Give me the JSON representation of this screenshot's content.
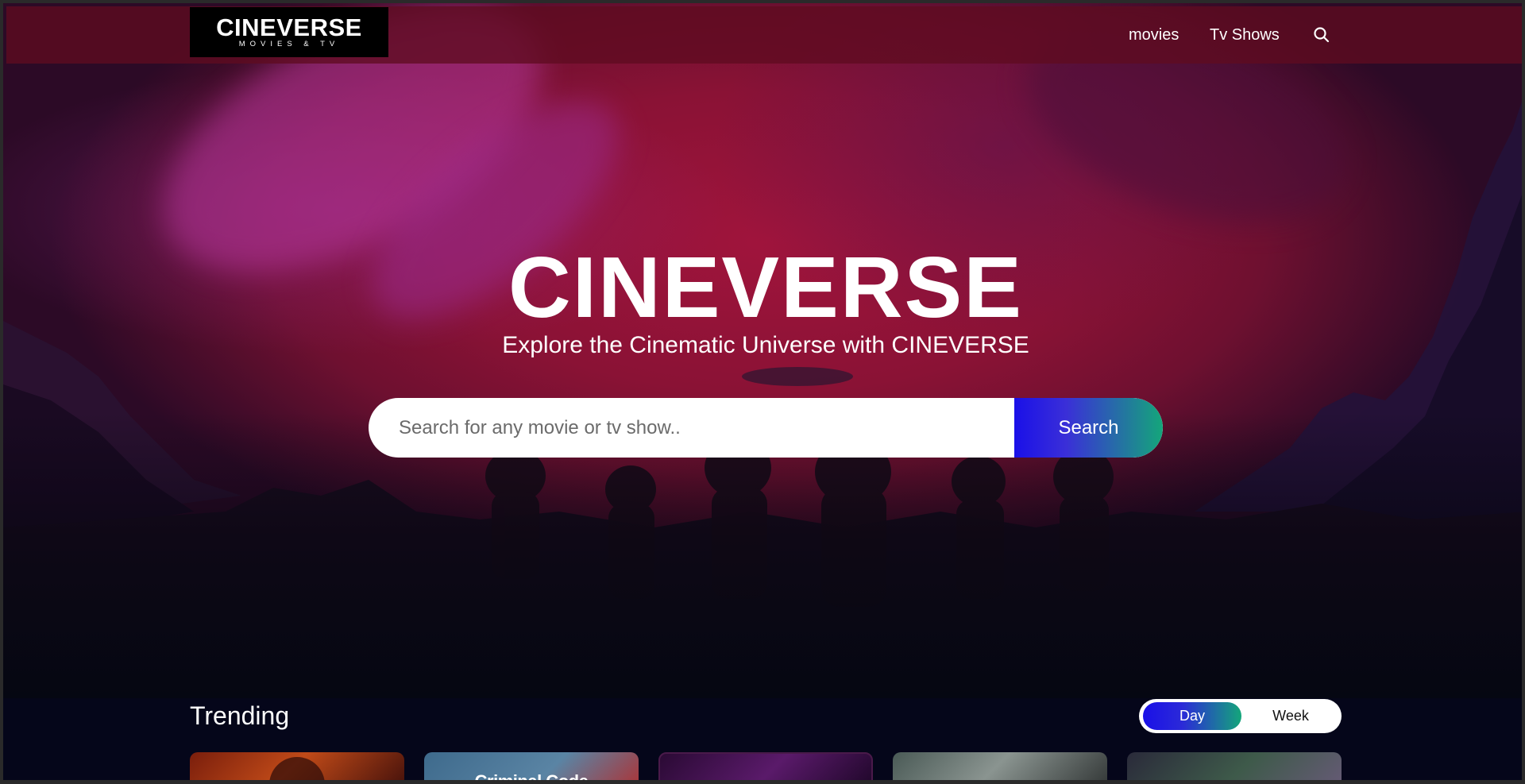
{
  "app": {
    "logo_main": "CINEVERSE",
    "logo_sub": "MOVIES & TV"
  },
  "nav": {
    "links": [
      {
        "label": "movies"
      },
      {
        "label": "Tv Shows"
      }
    ],
    "search_icon": "search-icon"
  },
  "hero": {
    "title": "CINEVERSE",
    "subtitle": "Explore the Cinematic Universe with CINEVERSE"
  },
  "search": {
    "placeholder": "Search for any movie or tv show..",
    "value": "",
    "button_label": "Search"
  },
  "trending": {
    "title": "Trending",
    "toggle": {
      "options": [
        "Day",
        "Week"
      ],
      "selected": "Day"
    },
    "cards": [
      {
        "label": ""
      },
      {
        "label": "Criminal Code"
      },
      {
        "label": ""
      },
      {
        "label": ""
      },
      {
        "label": ""
      }
    ]
  },
  "colors": {
    "hero_red": "#8a1235",
    "nav_bg": "#5f0c20",
    "accent_gradient_start": "#1a10e8",
    "accent_gradient_end": "#14a67a",
    "page_bg": "#05061a"
  }
}
